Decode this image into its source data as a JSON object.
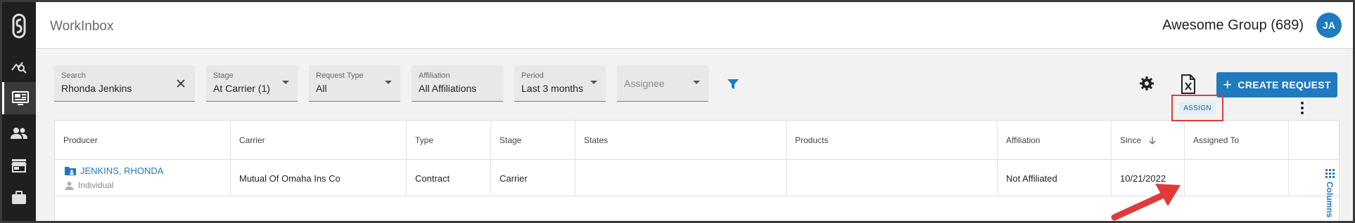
{
  "header": {
    "app_title": "WorkInbox",
    "group_name": "Awesome Group (689)",
    "avatar_initials": "JA"
  },
  "sidebar": {
    "items": [
      {
        "icon": "analytics-icon"
      },
      {
        "icon": "workinbox-icon",
        "active": true
      },
      {
        "icon": "people-icon"
      },
      {
        "icon": "store-icon"
      },
      {
        "icon": "briefcase-icon"
      }
    ]
  },
  "filters": {
    "search": {
      "label": "Search",
      "value": "Rhonda Jenkins"
    },
    "stage": {
      "label": "Stage",
      "value": "At Carrier (1)"
    },
    "request_type": {
      "label": "Request Type",
      "value": "All"
    },
    "affiliation": {
      "label": "Affiliation",
      "value": "All Affiliations"
    },
    "period": {
      "label": "Period",
      "value": "Last 3 months"
    },
    "assignee": {
      "placeholder": "Assignee"
    }
  },
  "toolbar": {
    "create_label": "CREATE REQUEST"
  },
  "table": {
    "headers": {
      "producer": "Producer",
      "carrier": "Carrier",
      "type": "Type",
      "stage": "Stage",
      "states": "States",
      "products": "Products",
      "affiliation": "Affiliation",
      "since": "Since",
      "assigned_to": "Assigned To"
    },
    "rows": [
      {
        "producer_name": "JENKINS, RHONDA",
        "producer_type": "Individual",
        "carrier": "Mutual Of Omaha Ins Co",
        "type": "Contract",
        "stage": "Carrier",
        "states": "",
        "products": "",
        "affiliation": "Not Affiliated",
        "since": "10/21/2022",
        "assign_label": "ASSIGN"
      }
    ]
  },
  "columns_tab": "Columns",
  "colors": {
    "accent": "#1f7abf",
    "sidebar": "#1f1f1f",
    "highlight": "#e03a3a"
  }
}
